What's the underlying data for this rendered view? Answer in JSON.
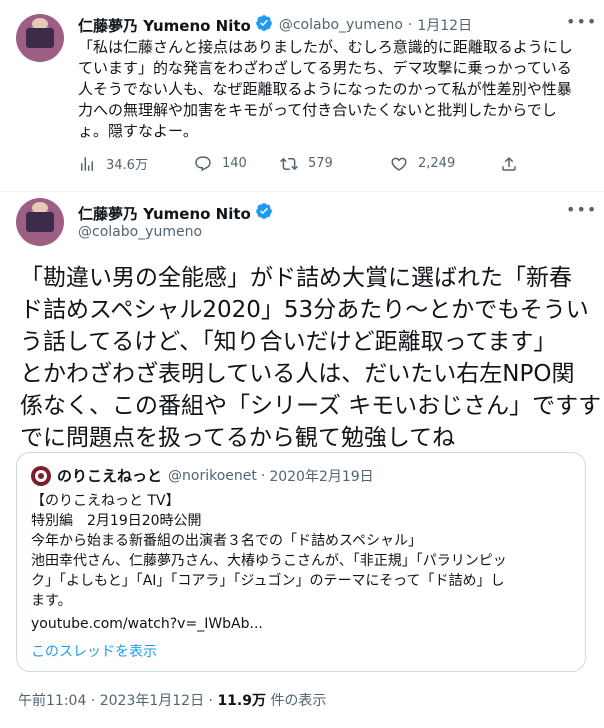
{
  "tweet1": {
    "author_name": "仁藤夢乃 Yumeno Nito",
    "handle": "@colabo_yumeno",
    "separator": "·",
    "date": "1月12日",
    "lines": [
      "「私は仁藤さんと接点はありましたが、むしろ意識的に距離取るようにし",
      "ています」的な発言をわざわざしてる男たち、デマ攻撃に乗っかっている",
      "人そうでない人も、なぜ距離取るようになったのかって私が性差別や性暴",
      "力への無理解や加害をキモがって付き合いたくないと批判したからでし",
      "ょ。隠すなよー。"
    ],
    "views": "34.6万",
    "replies": "140",
    "retweets": "579",
    "likes": "2,249"
  },
  "tweet2": {
    "author_name": "仁藤夢乃 Yumeno Nito",
    "handle": "@colabo_yumeno",
    "lines": [
      "「勘違い男の全能感」がド詰め大賞に選ばれた「新春",
      "ド詰めスペシャル2020」53分あたり〜とかでもそうい",
      "う話してるけど、「知り合いだけど距離取ってます」",
      "とかわざわざ表明している人は、だいたい右左NPO関",
      "係なく、この番組や「シリーズ キモいおじさん」ですす",
      "でに問題点を扱ってるから観て勉強してね"
    ],
    "quote": {
      "author_name": "のりこえねっと",
      "handle": "@norikoenet",
      "separator": "·",
      "date": "2020年2月19日",
      "lines": [
        "【のりこえねっと TV】",
        "特別編　2月19日20時公開",
        "今年から始まる新番組の出演者３名での「ド詰めスペシャル」",
        "池田幸代さん、仁藤夢乃さん、大椿ゆうこさんが、「非正規」「パラリンピッ",
        "ク」「よしもと」「AI」「コアラ」「ジュゴン」のテーマにそって「ド詰め」し",
        "ます。",
        "youtube.com/watch?v=_IWbAb..."
      ],
      "show_thread": "このスレッドを表示"
    },
    "time": "午前11:04",
    "date": "2023年1月12日",
    "views_count": "11.9万",
    "views_label": "件の表示"
  },
  "colors": {
    "verified": "#1d9bf0",
    "muted": "#536471",
    "link": "#1d9bf0",
    "border": "#cfd9de"
  }
}
